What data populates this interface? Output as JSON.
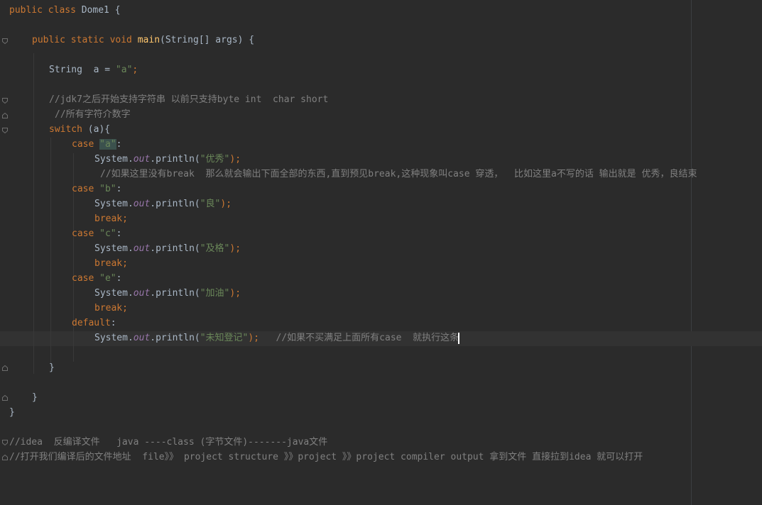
{
  "code": {
    "l1_kw": "public class",
    "l1_rest": " Dome1 {",
    "l2_kw": "public static void",
    "l2_fn": "main",
    "l2_rest": "(String[] args) {",
    "l3_type": "String  a = ",
    "l3_str": "\"a\"",
    "l3_semi": ";",
    "l4_cm": "//jdk7之后开始支持字符串 以前只支持byte int  char short",
    "l5_cm": "//所有字符介数字",
    "l6_kw": "switch",
    "l6_rest": " (a){",
    "l7_kw": "case",
    "l7_str": "\"a\"",
    "l7_colon": ":",
    "l8_pre": "System.",
    "l8_out": "out",
    "l8_mid": ".println(",
    "l8_str": "\"优秀\"",
    "l8_end": ");",
    "l9_cm": "//如果这里没有break  那么就会输出下面全部的东西,直到预见break,这种现象叫case 穿透，  比如这里a不写的话 输出就是 优秀，良结束",
    "l10_kw": "case",
    "l10_str": "\"b\"",
    "l11_str": "\"良\"",
    "l12_kw": "break;",
    "l13_kw": "case",
    "l13_str": "\"c\"",
    "l14_str": "\"及格\"",
    "l15_kw": "break;",
    "l16_kw": "case",
    "l16_str": "\"e\"",
    "l17_str": "\"加油\"",
    "l18_kw": "break;",
    "l19_kw": "default",
    "l20_str": "\"未知登记\"",
    "l20_end": ");",
    "l20_cm": "//如果不买满足上面所有case  就执行这条",
    "close_brace": "}",
    "l27_cm": "//idea  反编译文件   java ----class (字节文件)-------java文件",
    "l28_cm": "//打开我们编译后的文件地址  file》》 project structure 》》project 》》project compiler output 拿到文件 直接拉到idea 就可以打开"
  },
  "colors": {
    "background": "#2b2b2b",
    "keyword": "#cc7832",
    "function": "#ffc66d",
    "string": "#6a8759",
    "static_field": "#9876aa",
    "comment": "#808080",
    "text": "#a9b7c6",
    "caret_line": "#323232"
  },
  "icons": [
    "fold-marker-icon"
  ]
}
